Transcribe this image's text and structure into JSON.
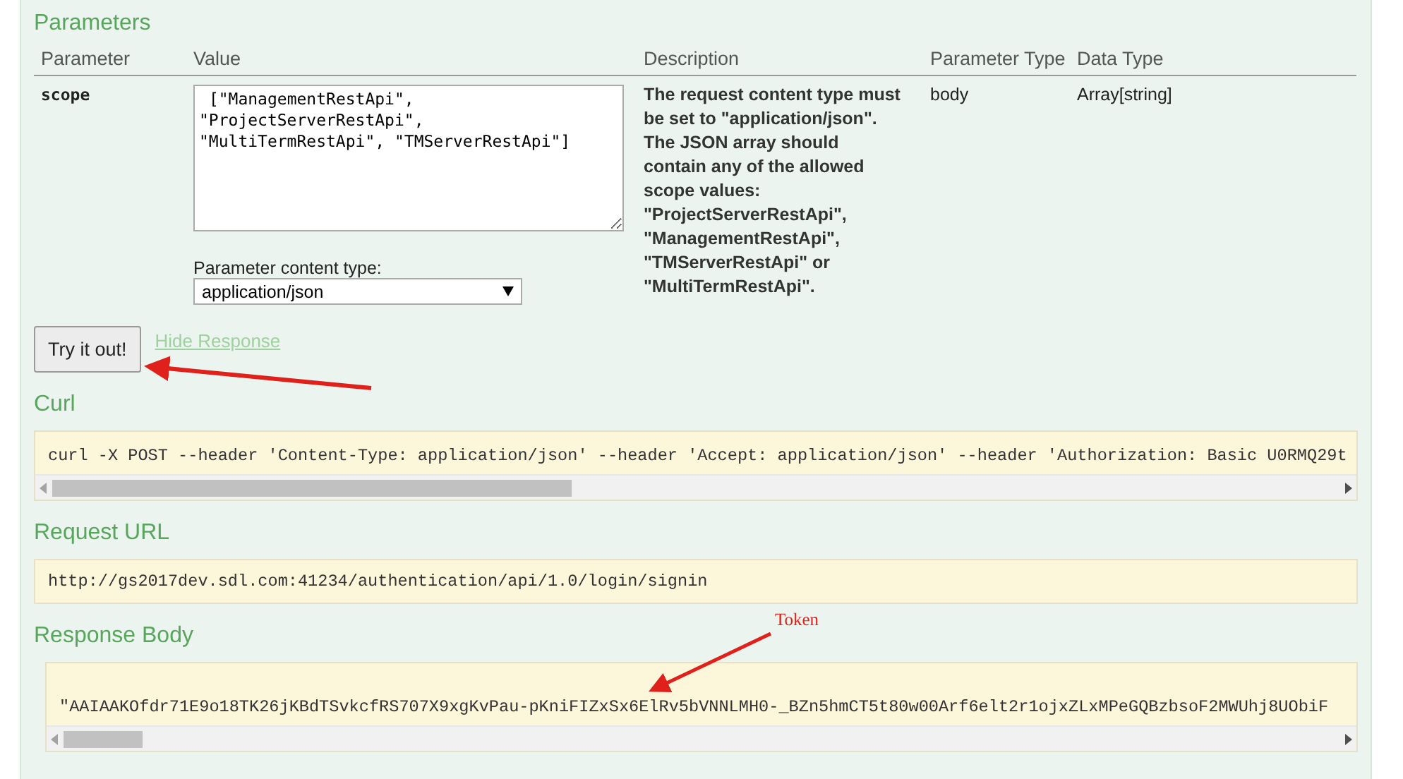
{
  "parameters": {
    "title": "Parameters",
    "columns": [
      "Parameter",
      "Value",
      "Description",
      "Parameter Type",
      "Data Type"
    ],
    "rows": [
      {
        "name": "scope",
        "value": " [\"ManagementRestApi\",\n\"ProjectServerRestApi\",\n\"MultiTermRestApi\", \"TMServerRestApi\"]",
        "content_type_label": "Parameter content type:",
        "content_type": "application/json",
        "description": "The request content type must be set to \"application/json\". The JSON array should contain any of the allowed scope values: \"ProjectServerRestApi\", \"ManagementRestApi\", \"TMServerRestApi\" or \"MultiTermRestApi\".",
        "parameter_type": "body",
        "data_type": "Array[string]"
      }
    ]
  },
  "try_button": "Try it out!",
  "hide_link": "Hide Response",
  "sections": [
    {
      "title": "Curl",
      "text": "curl -X POST --header 'Content-Type: application/json' --header 'Accept: application/json' --header 'Authorization: Basic U0RMQ29t",
      "kind": "scroll"
    },
    {
      "title": "Request URL",
      "text": "http://gs2017dev.sdl.com:41234/authentication/api/1.0/login/signin",
      "kind": "plain"
    },
    {
      "title": "Response Body",
      "text": "\"AAIAAKOfdr71E9o18TK26jKBdTSvkcfRS707X9xgKvPau-pKniFIZxSx6ElRv5bVNNLMH0-_BZn5hmCT5t80w00Arf6elt2r1ojxZLxMPeGQBzbsoF2MWUhj8UObiF",
      "kind": "scroll"
    }
  ],
  "annotation": "Token"
}
